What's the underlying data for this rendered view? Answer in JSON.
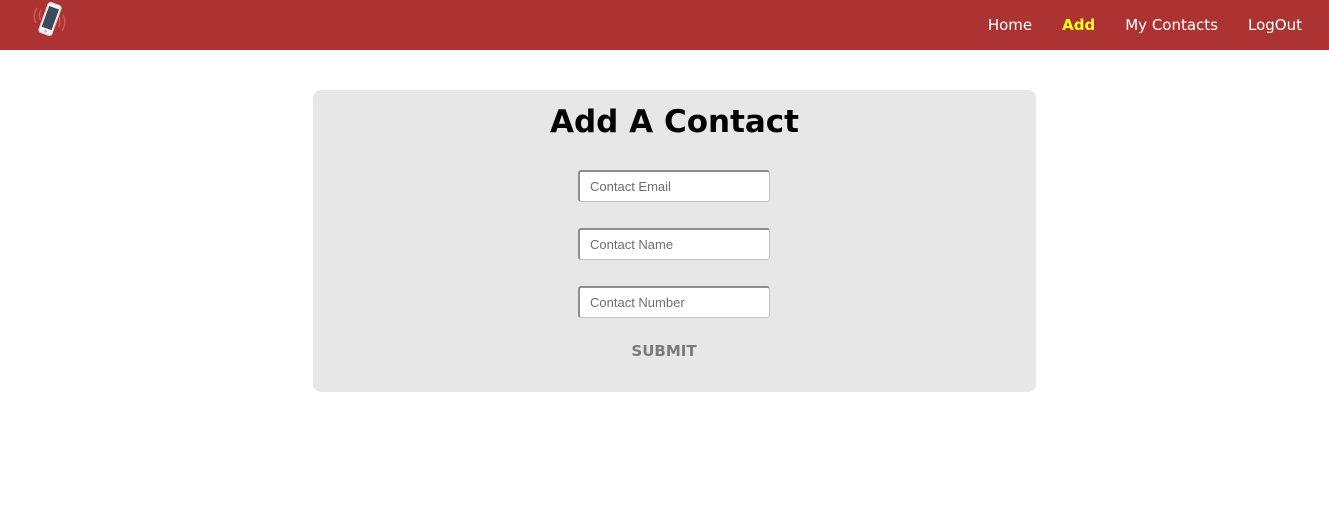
{
  "nav": {
    "logo_icon": "phone-ringing-icon",
    "items": [
      {
        "label": "Home",
        "active": false
      },
      {
        "label": "Add",
        "active": true
      },
      {
        "label": "My Contacts",
        "active": false
      },
      {
        "label": "LogOut",
        "active": false
      }
    ]
  },
  "form": {
    "title": "Add A Contact",
    "email_placeholder": "Contact Email",
    "name_placeholder": "Contact Name",
    "number_placeholder": "Contact Number",
    "submit_label": "SUBMIT"
  },
  "colors": {
    "navbar": "#ad3333",
    "active_link": "#ffff1a",
    "card": "#e7e7e7",
    "submit_text": "#7a7a7a"
  }
}
